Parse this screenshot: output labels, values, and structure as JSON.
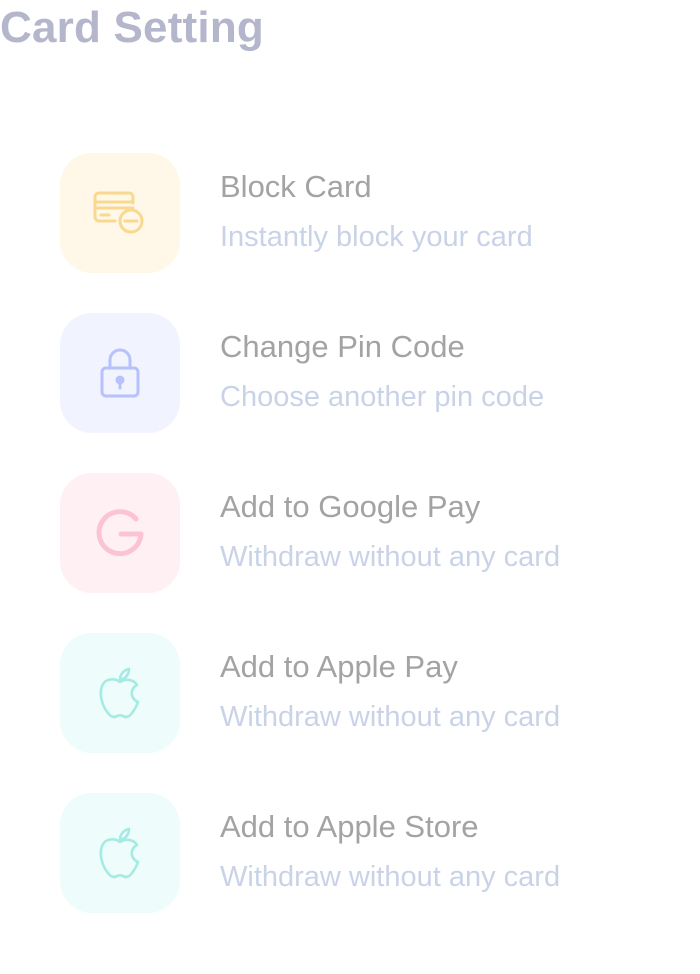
{
  "page": {
    "title": "Card Setting"
  },
  "settings": [
    {
      "title": "Block Card",
      "subtitle": "Instantly block your card",
      "icon": "card-block-icon",
      "tile_color": "#fff8e8",
      "icon_color": "#f8d98f"
    },
    {
      "title": "Change Pin Code",
      "subtitle": "Choose another pin code",
      "icon": "lock-icon",
      "tile_color": "#f1f4ff",
      "icon_color": "#b7c1fb"
    },
    {
      "title": "Add to Google Pay",
      "subtitle": "Withdraw without any card",
      "icon": "google-icon",
      "tile_color": "#fff0f4",
      "icon_color": "#fbc3d4"
    },
    {
      "title": "Add to Apple Pay",
      "subtitle": "Withdraw without any card",
      "icon": "apple-icon",
      "tile_color": "#eefcfb",
      "icon_color": "#a3ece4"
    },
    {
      "title": "Add to Apple Store",
      "subtitle": "Withdraw without any card",
      "icon": "apple-icon",
      "tile_color": "#eefcfb",
      "icon_color": "#a3ece4"
    }
  ]
}
